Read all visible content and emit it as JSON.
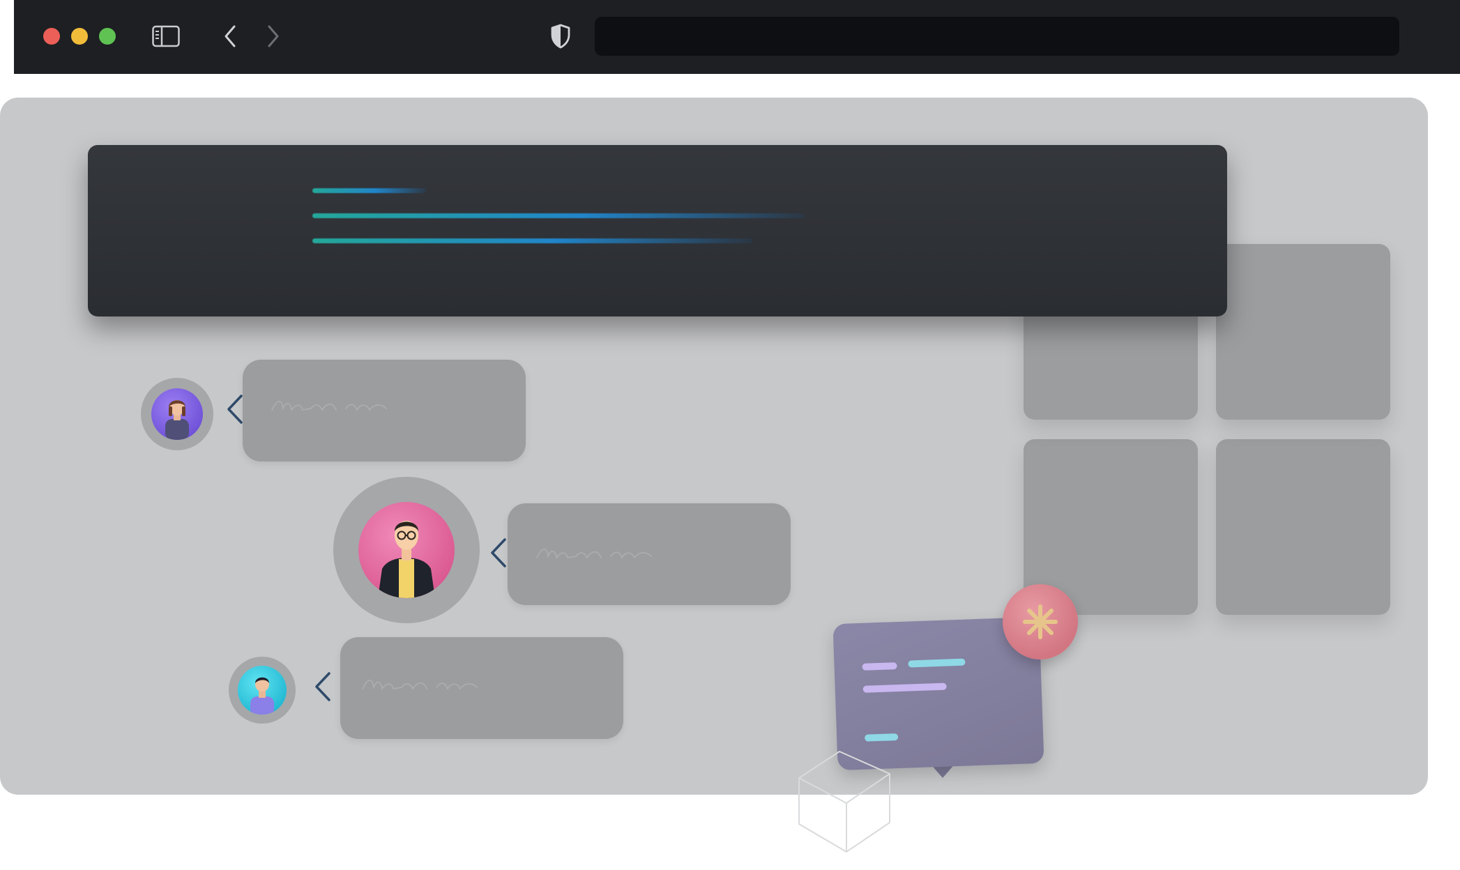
{
  "browser": {
    "address_value": "",
    "icons": {
      "sidebar_toggle": "sidebar-icon",
      "back": "chevron-left-icon",
      "forward": "chevron-right-icon",
      "privacy": "shield-icon"
    },
    "window_controls": [
      "close",
      "minimize",
      "zoom"
    ]
  },
  "page": {
    "banner": {
      "placeholder_lines": 3
    },
    "comments": [
      {
        "avatar": "woman-avatar",
        "text": ""
      },
      {
        "avatar": "man-glasses-avatar",
        "text": ""
      },
      {
        "avatar": "man-avatar",
        "text": ""
      }
    ],
    "tiles": 4,
    "chat_sticker": {
      "icon": "chat-bubble-icon",
      "badge_icon": "asterisk-icon"
    }
  },
  "colors": {
    "chrome": "#1d1f22",
    "page_bg": "#c7c8ca",
    "banner": "#2f3237",
    "tile": "#9c9d9f",
    "accent_teal": "#24a89a",
    "accent_blue": "#2185c9",
    "caret": "#2e4a6a"
  }
}
